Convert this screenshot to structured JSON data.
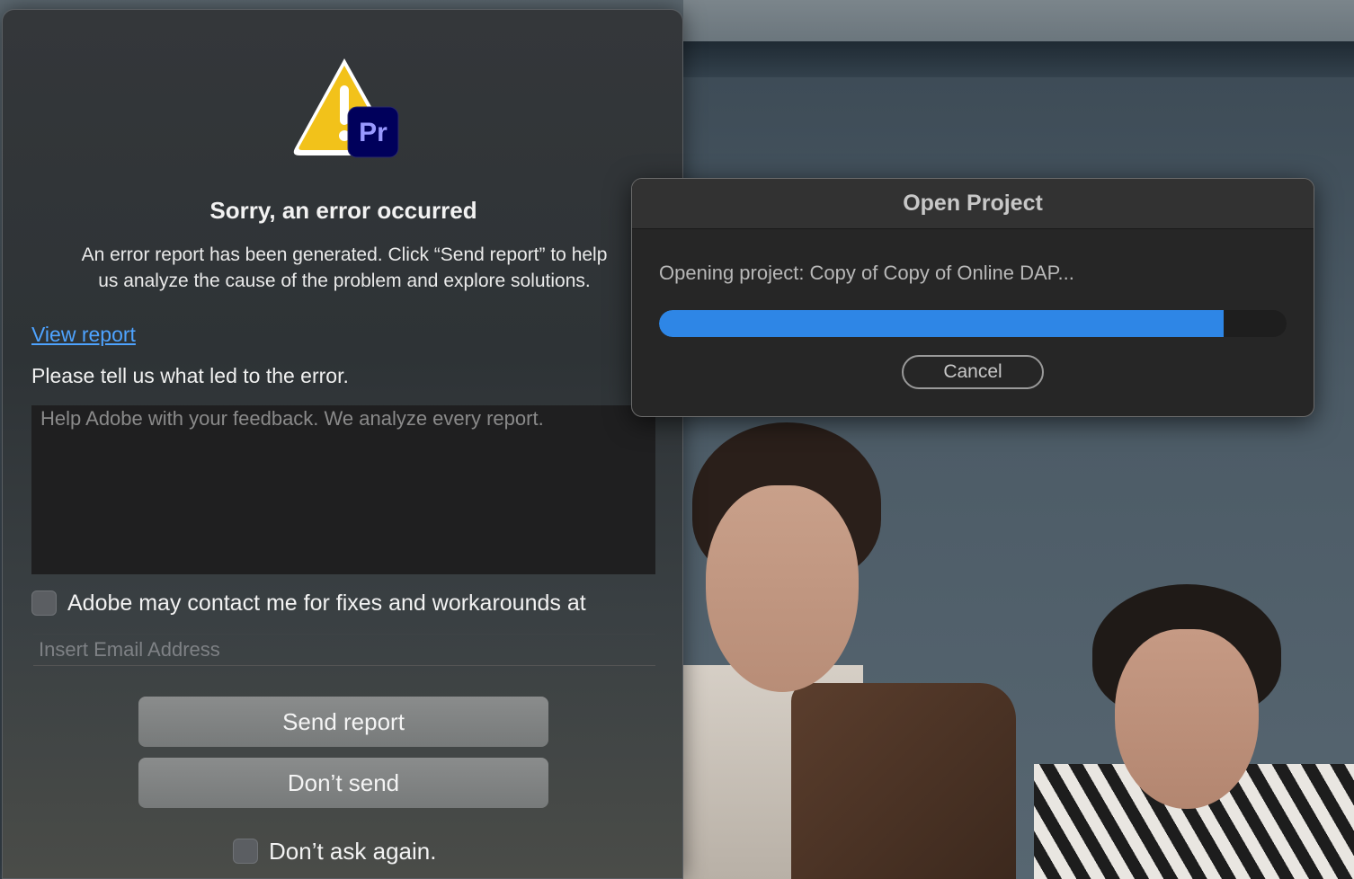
{
  "error_dialog": {
    "icon": "warning-triangle-with-premiere-pro-badge",
    "badge_text": "Pr",
    "title": "Sorry, an error occurred",
    "message_line1": "An error report has been generated. Click “Send report” to help",
    "message_line2": "us analyze the cause of the problem and explore solutions.",
    "view_report_label": "View report",
    "prompt_label": "Please tell us what led to the error.",
    "feedback_placeholder": "Help Adobe with your feedback. We analyze every report.",
    "feedback_value": "",
    "contact_label": "Adobe may contact me for fixes and workarounds at",
    "contact_checked": false,
    "email_placeholder": "Insert Email Address",
    "email_value": "",
    "send_label": "Send report",
    "dont_send_label": "Don’t send",
    "dont_ask_label": "Don’t ask again.",
    "dont_ask_checked": false
  },
  "open_project": {
    "title": "Open Project",
    "status": "Opening project: Copy of Copy of Online DAP...",
    "progress_fraction": 0.9,
    "cancel_label": "Cancel"
  },
  "colors": {
    "link": "#4ea3ff",
    "progress": "#2e86e6",
    "badge_bg": "#00005b",
    "badge_text": "#9999ff",
    "warning": "#f2c21a"
  }
}
